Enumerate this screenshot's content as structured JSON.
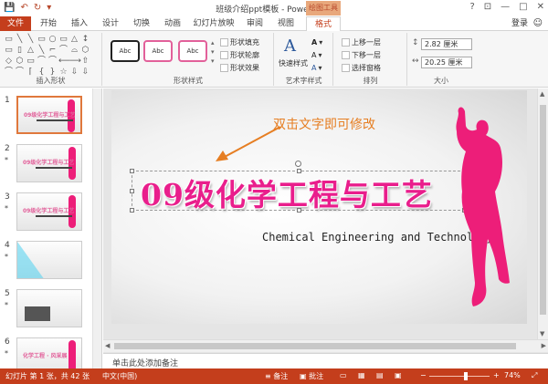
{
  "titlebar": {
    "title": "班级介绍ppt模板 - PowerPoint",
    "context_tab": "绘图工具",
    "qat": {
      "save": "💾",
      "undo": "↶",
      "redo": "↻",
      "customize": "▾"
    },
    "window_buttons": {
      "help": "?",
      "ribbon": "⊡",
      "minimize": "—",
      "maximize": "□",
      "close": "✕"
    }
  },
  "tabs": {
    "file": "文件",
    "items": [
      "开始",
      "插入",
      "设计",
      "切换",
      "动画",
      "幻灯片放映",
      "审阅",
      "视图",
      "格式"
    ],
    "active": "格式",
    "login": "登录"
  },
  "ribbon": {
    "insert_shapes": {
      "label": "插入形状",
      "shapes": [
        "▭",
        "╲",
        "╲",
        "▭",
        "○",
        "▭",
        "△",
        "↕",
        "▭",
        "▯",
        "△",
        "╲",
        "⌐",
        "⌒",
        "⌓",
        "⬡",
        "◇",
        "⬡",
        "▭",
        "⌒",
        "⌒",
        "⟵",
        "⟶",
        "⇧",
        "⌒",
        "⌒",
        "⌈",
        "{",
        "}",
        "☆",
        "⇩",
        "⇩"
      ]
    },
    "shape_styles": {
      "label": "形状样式",
      "gallery": [
        "Abc",
        "Abc",
        "Abc"
      ],
      "fill": "形状填充",
      "outline": "形状轮廓",
      "effects": "形状效果"
    },
    "wordart": {
      "label": "艺术字样式",
      "quick_style": "快速样式",
      "glyph": "A"
    },
    "arrange": {
      "label": "排列",
      "bring_forward": "上移一层",
      "send_backward": "下移一层",
      "selection_pane": "选择窗格"
    },
    "size": {
      "label": "大小",
      "height": "2.82 厘米",
      "width": "20.25 厘米"
    }
  },
  "thumbnails": [
    {
      "number": "1",
      "star": "",
      "active": true,
      "title": "09级化学工程与工艺",
      "subtitle": "Chemical Engineering and Technology"
    },
    {
      "number": "2",
      "star": "*",
      "active": false,
      "title": "09级化学工程与工艺",
      "subtitle": "Chemical Engineering and Technology"
    },
    {
      "number": "3",
      "star": "*",
      "active": false,
      "title": "09级化学工程与工艺",
      "subtitle": ""
    },
    {
      "number": "4",
      "star": "*",
      "active": false,
      "title": "",
      "subtitle": ""
    },
    {
      "number": "5",
      "star": "*",
      "active": false,
      "title": "",
      "subtitle": ""
    },
    {
      "number": "6",
      "star": "*",
      "active": false,
      "title": "化学工程 · 风采展",
      "subtitle": ""
    }
  ],
  "slide": {
    "annotation": "双击文字即可修改",
    "title": "09级化学工程与工艺",
    "subtitle": "Chemical Engineering and Technology"
  },
  "notes": {
    "placeholder": "单击此处添加备注"
  },
  "statusbar": {
    "slide_info": "幻灯片 第 1 张，共 42 张",
    "language": "中文(中国)",
    "notes_button": "备注",
    "comments_button": "批注",
    "zoom_minus": "−",
    "zoom_plus": "+",
    "zoom": "74%",
    "zoom_fraction": 0.6
  },
  "colors": {
    "accent": "#c43e1c",
    "title_pink": "#e91e8c",
    "figure_pink": "#ed1e79",
    "annotation_orange": "#e67e22"
  }
}
